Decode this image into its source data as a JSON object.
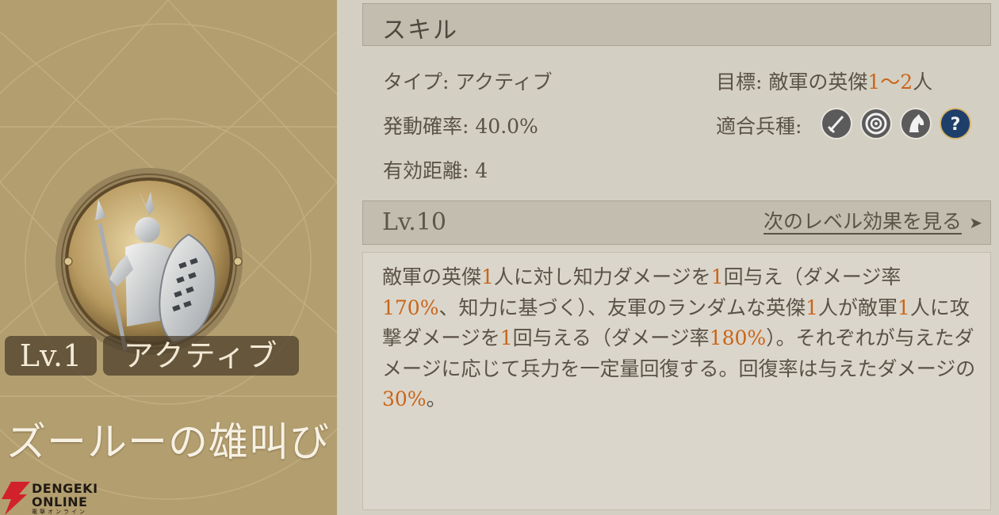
{
  "card": {
    "level": "Lv.1",
    "type": "アクティブ",
    "name": "ズールーの雄叫び",
    "emblem_icon": "zulu-warrior-icon"
  },
  "skill": {
    "header": "スキル",
    "type_label": "タイプ:",
    "type_value": "アクティブ",
    "target_label": "目標:",
    "target_prefix": "敵軍の英傑",
    "target_range": "1～2",
    "target_suffix": "人",
    "rate_label": "発動確率:",
    "rate_value": "40.0%",
    "troop_label": "適合兵種:",
    "range_label": "有効距離:",
    "range_value": "4",
    "troop_icons": [
      "sword-icon",
      "bow-target-icon",
      "cavalry-horse-icon",
      "question-icon"
    ]
  },
  "level": {
    "label": "Lv.10",
    "next_link": "次のレベル効果を見る",
    "arrow": "➤"
  },
  "description": {
    "p1": "敵軍の英傑",
    "h1": "1",
    "p2": "人に対し知力ダメージを",
    "h2": "1",
    "p3": "回与え（ダメージ率",
    "h3": "170%",
    "p4": "、知力に基づく）、友軍のランダムな英傑",
    "h4": "1",
    "p5": "人が敵軍",
    "h5": "1",
    "p6": "人に攻撃ダメージを",
    "h6": "1",
    "p7": "回与える（ダメージ率",
    "h7": "180%",
    "p8": "）。それぞれが与えたダメージに応じて兵力を一定量回復する。回復率は与えたダメージの",
    "h8": "30%",
    "p9": "。"
  },
  "watermark": {
    "line1": "DENGEKI",
    "line2": "ONLINE",
    "line3": "電撃オンライン"
  },
  "colors": {
    "highlight": "#c9651a",
    "card": "#b39e6f",
    "panel": "#d4cfc3"
  }
}
